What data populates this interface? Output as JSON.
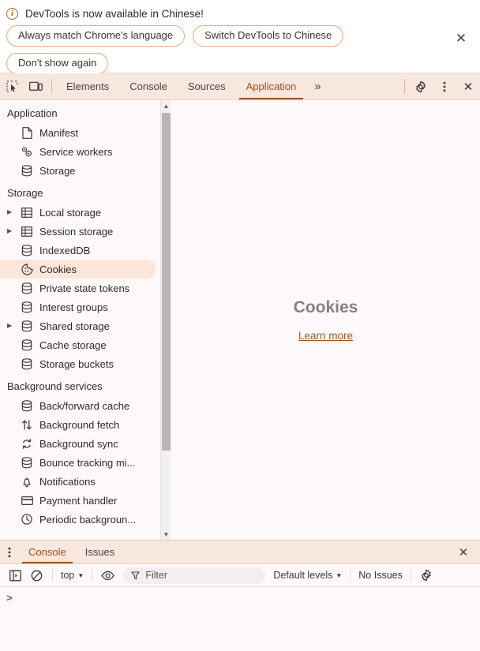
{
  "banner": {
    "icon": "info-icon",
    "title": "DevTools is now available in Chinese!",
    "buttons": [
      {
        "label": "Always match Chrome's language",
        "name": "always-match-language-button"
      },
      {
        "label": "Switch DevTools to Chinese",
        "name": "switch-to-chinese-button"
      },
      {
        "label": "Don't show again",
        "name": "dont-show-again-button"
      }
    ],
    "close_label": "✕",
    "accent": "#b5651d",
    "border": "#e8a87c"
  },
  "tabbar": {
    "inspect_icon": "inspect-element-icon",
    "device_icon": "device-toolbar-icon",
    "tabs": [
      {
        "label": "Elements",
        "active": false
      },
      {
        "label": "Console",
        "active": false
      },
      {
        "label": "Sources",
        "active": false
      },
      {
        "label": "Application",
        "active": true
      }
    ],
    "more_tabs_label": "»",
    "settings_icon": "gear-icon",
    "menu_icon": "kebab-menu-icon",
    "close_label": "✕",
    "active_color": "#a8500a",
    "background": "#f7e7df"
  },
  "sidebar": {
    "sections": [
      {
        "title": "Application",
        "items": [
          {
            "label": "Manifest",
            "icon": "document-icon",
            "twisty": false,
            "selected": false
          },
          {
            "label": "Service workers",
            "icon": "gears-icon",
            "twisty": false,
            "selected": false
          },
          {
            "label": "Storage",
            "icon": "database-icon",
            "twisty": false,
            "selected": false
          }
        ]
      },
      {
        "title": "Storage",
        "items": [
          {
            "label": "Local storage",
            "icon": "table-icon",
            "twisty": true,
            "selected": false
          },
          {
            "label": "Session storage",
            "icon": "table-icon",
            "twisty": true,
            "selected": false
          },
          {
            "label": "IndexedDB",
            "icon": "database-icon",
            "twisty": false,
            "selected": false
          },
          {
            "label": "Cookies",
            "icon": "cookie-icon",
            "twisty": false,
            "selected": true
          },
          {
            "label": "Private state tokens",
            "icon": "database-icon",
            "twisty": false,
            "selected": false
          },
          {
            "label": "Interest groups",
            "icon": "database-icon",
            "twisty": false,
            "selected": false
          },
          {
            "label": "Shared storage",
            "icon": "database-icon",
            "twisty": true,
            "selected": false
          },
          {
            "label": "Cache storage",
            "icon": "database-icon",
            "twisty": false,
            "selected": false
          },
          {
            "label": "Storage buckets",
            "icon": "database-icon",
            "twisty": false,
            "selected": false
          }
        ]
      },
      {
        "title": "Background services",
        "items": [
          {
            "label": "Back/forward cache",
            "icon": "database-icon",
            "twisty": false,
            "selected": false
          },
          {
            "label": "Background fetch",
            "icon": "arrows-updown-icon",
            "twisty": false,
            "selected": false
          },
          {
            "label": "Background sync",
            "icon": "sync-icon",
            "twisty": false,
            "selected": false
          },
          {
            "label": "Bounce tracking mi...",
            "icon": "database-icon",
            "twisty": false,
            "selected": false
          },
          {
            "label": "Notifications",
            "icon": "bell-icon",
            "twisty": false,
            "selected": false
          },
          {
            "label": "Payment handler",
            "icon": "credit-card-icon",
            "twisty": false,
            "selected": false
          },
          {
            "label": "Periodic backgroun...",
            "icon": "clock-icon",
            "twisty": false,
            "selected": false
          }
        ]
      }
    ],
    "selected_background": "#fbe6d9",
    "scrollbar": {
      "up_arrow": "▲",
      "down_arrow": "▼"
    }
  },
  "content": {
    "title": "Cookies",
    "link_label": "Learn more",
    "title_color": "#8b807c",
    "link_color": "#9a5a22"
  },
  "drawer": {
    "menu_icon": "kebab-menu-icon",
    "tabs": [
      {
        "label": "Console",
        "active": true
      },
      {
        "label": "Issues",
        "active": false
      }
    ],
    "close_label": "✕",
    "toolbar": {
      "sidebar_toggle_icon": "console-sidebar-toggle-icon",
      "clear_icon": "clear-console-icon",
      "context_label": "top",
      "eye_icon": "live-expression-icon",
      "filter_icon": "filter-icon",
      "filter_placeholder": "Filter",
      "filter_value": "",
      "levels_label": "Default levels",
      "issues_label": "No Issues",
      "settings_icon": "gear-icon",
      "caret": "▼"
    },
    "prompt": ">"
  }
}
